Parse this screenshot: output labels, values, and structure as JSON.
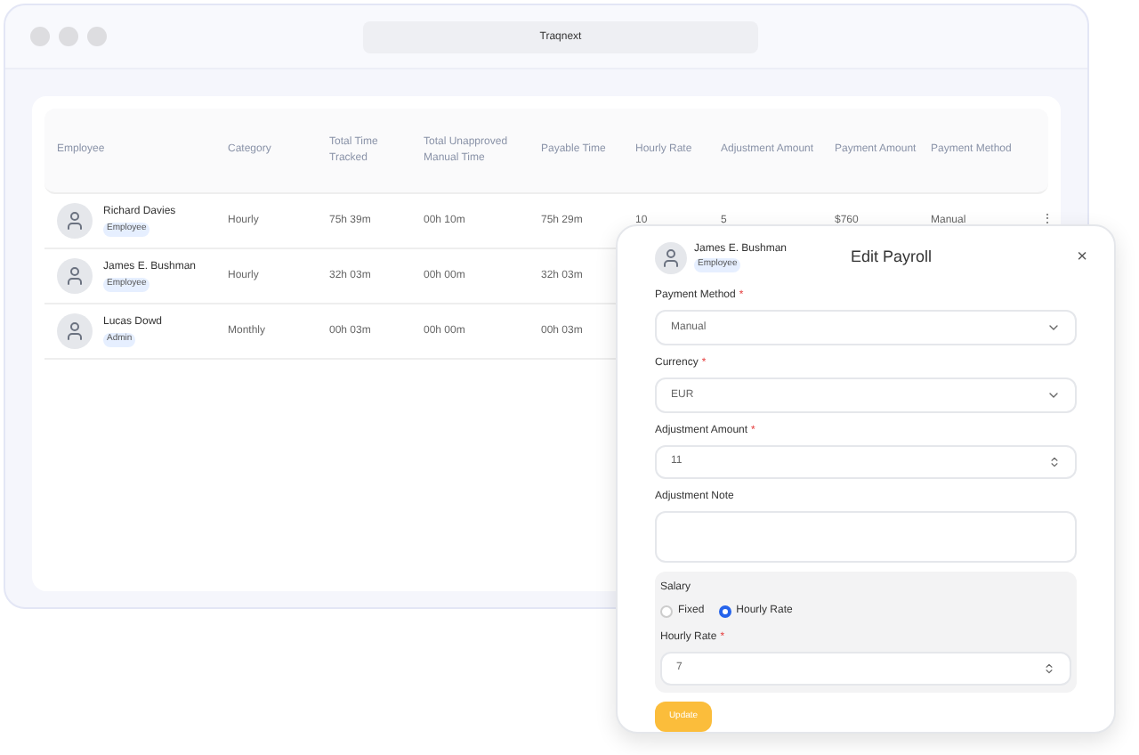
{
  "window": {
    "title": "Traqnext"
  },
  "table": {
    "columns": [
      "Employee",
      "Category",
      "Total Time Tracked",
      "Total Unapproved Manual Time",
      "Payable Time",
      "Hourly Rate",
      "Adjustment Amount",
      "Payment Amount",
      "Payment Method"
    ],
    "rows": [
      {
        "cells": [
          {
            "name": "Richard Davies",
            "role": "Employee"
          },
          "Hourly",
          "75h 39m",
          "00h 10m",
          "75h 29m",
          "10",
          "5",
          "$760",
          "Manual"
        ],
        "menu": "⋮"
      },
      {
        "cells": [
          {
            "name": "James E. Bushman",
            "role": "Employee"
          },
          "Hourly",
          "32h 03m",
          "00h 00m",
          "32h 03m"
        ]
      },
      {
        "cells": [
          {
            "name": "Lucas Dowd",
            "role": "Admin"
          },
          "Monthly",
          "00h 03m",
          "00h 00m",
          "00h 03m"
        ]
      }
    ]
  },
  "modal": {
    "title": "Edit Payroll",
    "close": "×",
    "employee": {
      "name": "James E. Bushman",
      "role": "Employee"
    },
    "fields": [
      {
        "kind": "select",
        "label": "Payment Method",
        "required_mark": "*",
        "value": "Manual"
      },
      {
        "kind": "select",
        "label": "Currency",
        "required_mark": "*",
        "value": "EUR"
      },
      {
        "kind": "number",
        "label": "Adjustment Amount",
        "required_mark": "*",
        "value": "11"
      },
      {
        "kind": "textarea",
        "label": "Adjustment Note"
      }
    ],
    "salary": {
      "label": "Salary",
      "options": [
        {
          "label": "Fixed",
          "selected": false
        },
        {
          "label": "Hourly Rate",
          "selected": true
        }
      ],
      "field": {
        "kind": "number",
        "label": "Hourly Rate",
        "required_mark": "*",
        "value": "7"
      }
    },
    "button": "Update"
  }
}
